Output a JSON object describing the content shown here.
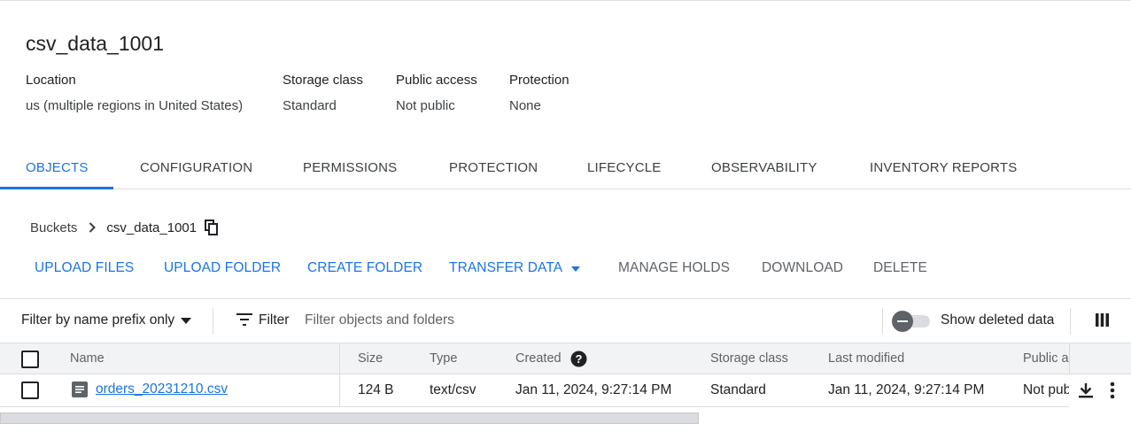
{
  "bucket": {
    "name": "csv_data_1001"
  },
  "metadata": [
    {
      "key": "Location",
      "value": "us (multiple regions in United States)"
    },
    {
      "key": "Storage class",
      "value": "Standard"
    },
    {
      "key": "Public access",
      "value": "Not public"
    },
    {
      "key": "Protection",
      "value": "None"
    }
  ],
  "tabs": [
    {
      "label": "OBJECTS",
      "active": true
    },
    {
      "label": "CONFIGURATION"
    },
    {
      "label": "PERMISSIONS"
    },
    {
      "label": "PROTECTION"
    },
    {
      "label": "LIFECYCLE"
    },
    {
      "label": "OBSERVABILITY"
    },
    {
      "label": "INVENTORY REPORTS"
    }
  ],
  "breadcrumb": {
    "root": "Buckets",
    "current": "csv_data_1001"
  },
  "actions": {
    "upload_files": "UPLOAD FILES",
    "upload_folder": "UPLOAD FOLDER",
    "create_folder": "CREATE FOLDER",
    "transfer_data": "TRANSFER DATA",
    "manage_holds": "MANAGE HOLDS",
    "download": "DOWNLOAD",
    "delete": "DELETE"
  },
  "filter": {
    "mode": "Filter by name prefix only",
    "label": "Filter",
    "placeholder": "Filter objects and folders",
    "show_deleted_label": "Show deleted data",
    "show_deleted": false
  },
  "table": {
    "headers": {
      "name": "Name",
      "size": "Size",
      "type": "Type",
      "created": "Created",
      "storage_class": "Storage class",
      "last_modified": "Last modified",
      "public_access": "Public a"
    },
    "rows": [
      {
        "name": "orders_20231210.csv",
        "size": "124 B",
        "type": "text/csv",
        "created": "Jan 11, 2024, 9:27:14 PM",
        "storage_class": "Standard",
        "last_modified": "Jan 11, 2024, 9:27:14 PM",
        "public_access": "Not pub"
      }
    ]
  },
  "colors": {
    "accent": "#1a73e8",
    "text": "#202124",
    "muted": "#5f6368",
    "divider": "#dadce0"
  }
}
